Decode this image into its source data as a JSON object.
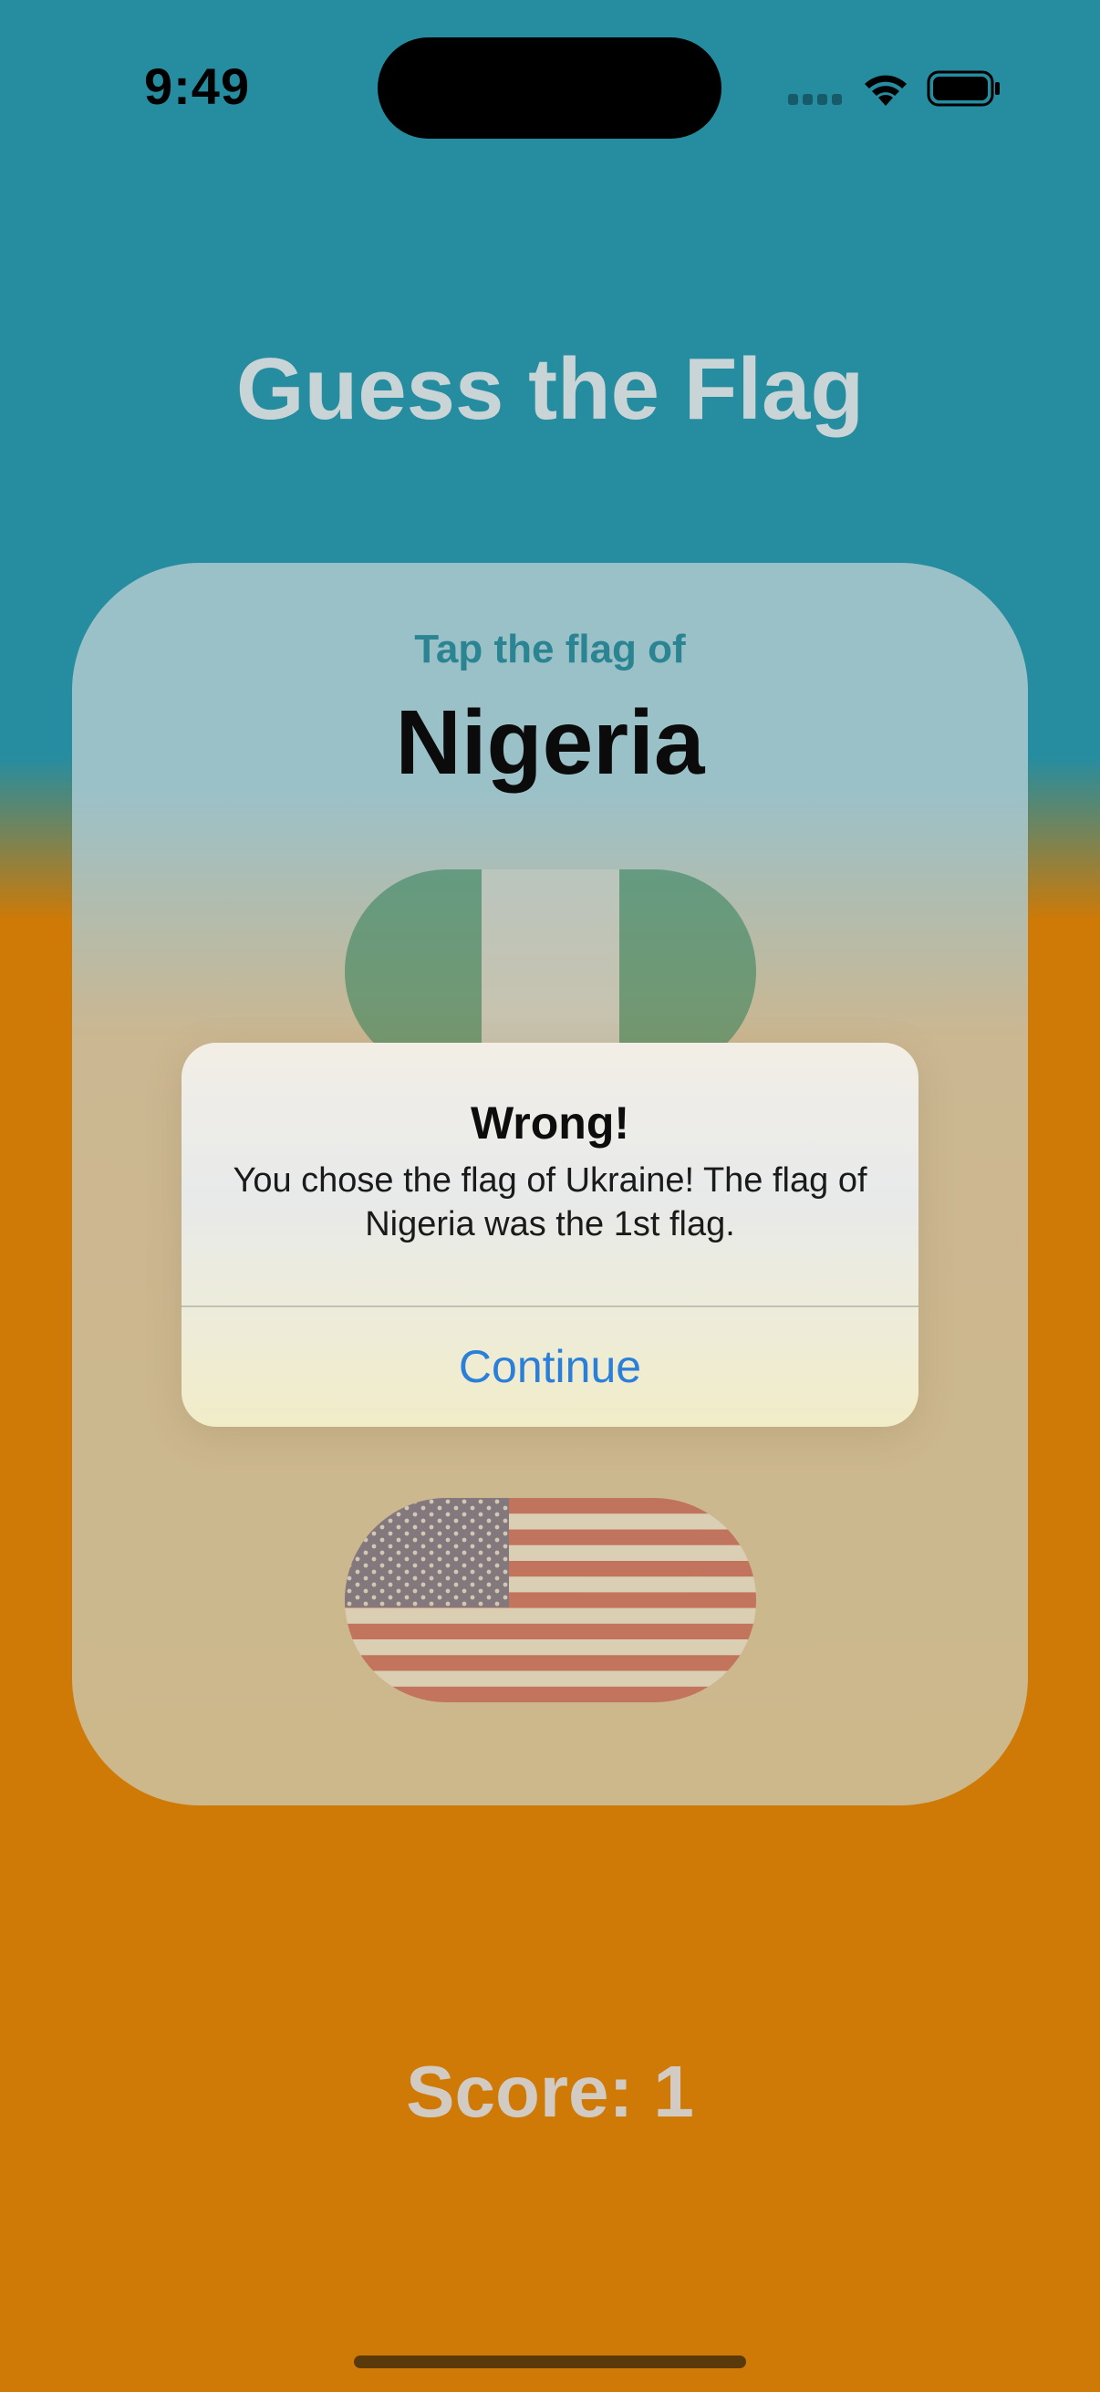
{
  "status_bar": {
    "time": "9:49"
  },
  "title": "Guess the Flag",
  "card": {
    "subtitle": "Tap the flag of",
    "country": "Nigeria",
    "flags": [
      {
        "name": "Nigeria flag",
        "icon": "flag-nigeria"
      },
      {
        "name": "United States flag",
        "icon": "flag-usa"
      }
    ]
  },
  "alert": {
    "title": "Wrong!",
    "message": "You chose the flag of Ukraine! The flag of Nigeria was the 1st flag.",
    "button_label": "Continue"
  },
  "score": "Score: 1",
  "colors": {
    "background_top": "#268da0",
    "background_bottom": "#cf7a06",
    "accent_blue": "#2a7fd8",
    "nigeria_green": "#2d7f56"
  }
}
